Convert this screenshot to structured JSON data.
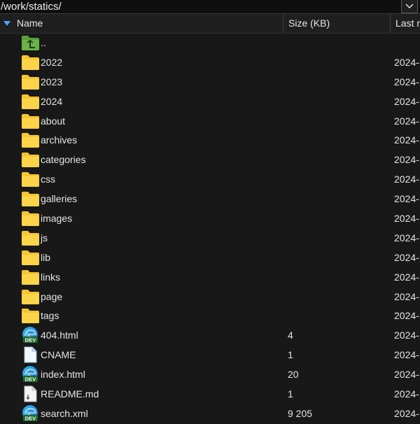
{
  "path": {
    "value": "/work/statics/"
  },
  "columns": {
    "name": "Name",
    "size": "Size (KB)",
    "last_modified": "Last m"
  },
  "rows": [
    {
      "name": "..",
      "icon": "parent-folder-icon",
      "size": "",
      "date": ""
    },
    {
      "name": "2022",
      "icon": "folder-icon",
      "size": "",
      "date": "2024-"
    },
    {
      "name": "2023",
      "icon": "folder-icon",
      "size": "",
      "date": "2024-"
    },
    {
      "name": "2024",
      "icon": "folder-icon",
      "size": "",
      "date": "2024-"
    },
    {
      "name": "about",
      "icon": "folder-icon",
      "size": "",
      "date": "2024-"
    },
    {
      "name": "archives",
      "icon": "folder-icon",
      "size": "",
      "date": "2024-"
    },
    {
      "name": "categories",
      "icon": "folder-icon",
      "size": "",
      "date": "2024-"
    },
    {
      "name": "css",
      "icon": "folder-icon",
      "size": "",
      "date": "2024-"
    },
    {
      "name": "galleries",
      "icon": "folder-icon",
      "size": "",
      "date": "2024-"
    },
    {
      "name": "images",
      "icon": "folder-icon",
      "size": "",
      "date": "2024-"
    },
    {
      "name": "js",
      "icon": "folder-icon",
      "size": "",
      "date": "2024-"
    },
    {
      "name": "lib",
      "icon": "folder-icon",
      "size": "",
      "date": "2024-"
    },
    {
      "name": "links",
      "icon": "folder-icon",
      "size": "",
      "date": "2024-"
    },
    {
      "name": "page",
      "icon": "folder-icon",
      "size": "",
      "date": "2024-"
    },
    {
      "name": "tags",
      "icon": "folder-icon",
      "size": "",
      "date": "2024-"
    },
    {
      "name": "404.html",
      "icon": "edge-dev-icon",
      "size": "4",
      "date": "2024-"
    },
    {
      "name": "CNAME",
      "icon": "file-icon",
      "size": "1",
      "date": "2024-"
    },
    {
      "name": "index.html",
      "icon": "edge-dev-icon",
      "size": "20",
      "date": "2024-"
    },
    {
      "name": "README.md",
      "icon": "markdown-file-icon",
      "size": "1",
      "date": "2024-"
    },
    {
      "name": "search.xml",
      "icon": "edge-dev-icon",
      "size": "9 205",
      "date": "2024-"
    }
  ],
  "badge_text": "DEV",
  "colors": {
    "background": "#181818",
    "header": "#1f1f1f",
    "folder": "#f7c531",
    "parent_folder": "#5a9e3a",
    "sort_arrow": "#4fa3ff"
  }
}
